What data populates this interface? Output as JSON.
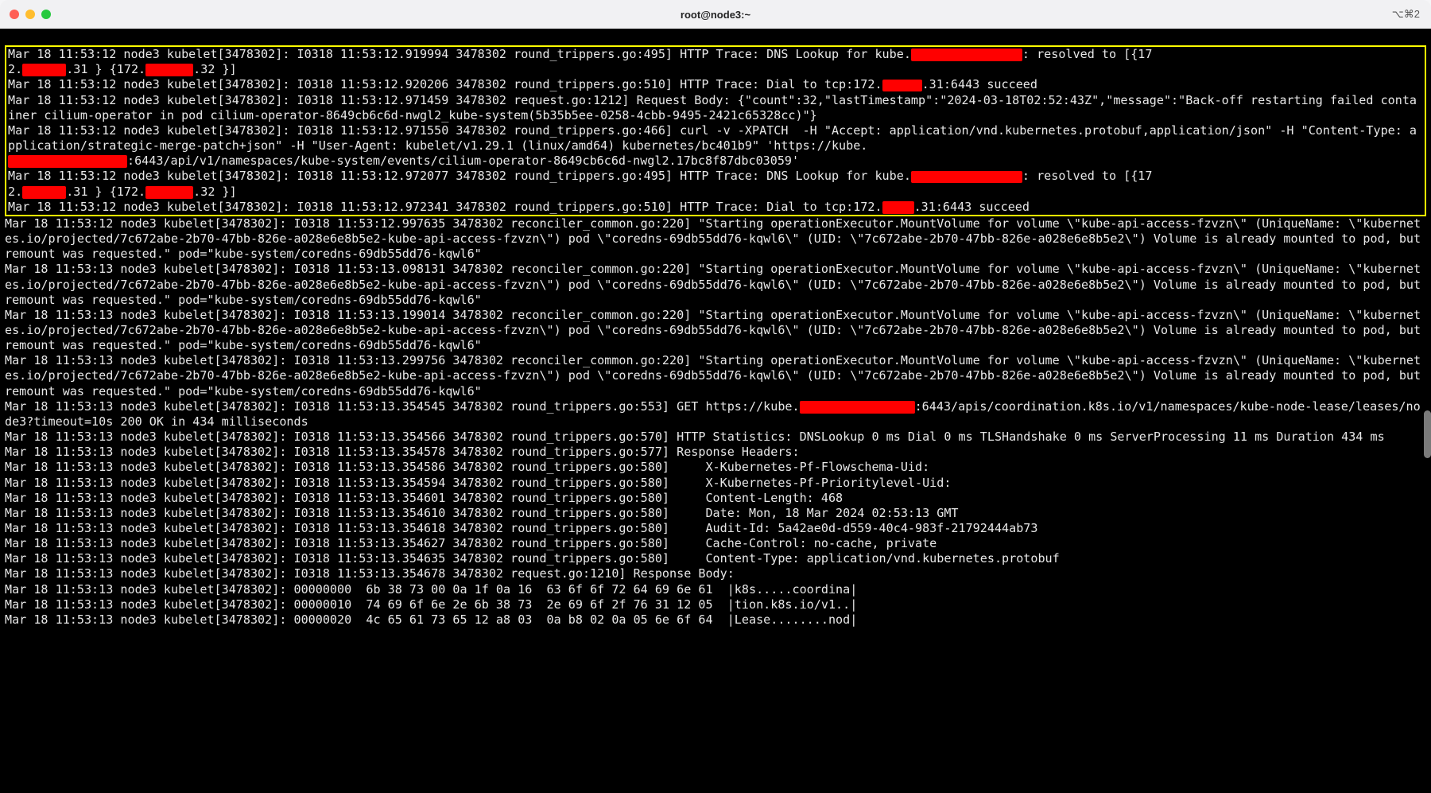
{
  "window": {
    "title": "root@node3:~",
    "shortcut": "⌥⌘2"
  },
  "highlighted_log_lines": [
    "Mar 18 11:53:12 node3 kubelet[3478302]: I0318 11:53:12.919994 3478302 round_trippers.go:495] HTTP Trace: DNS Lookup for kube.",
    ": resolved to [{17",
    "2.",
    ".31 } {172.",
    ".32 }]",
    "Mar 18 11:53:12 node3 kubelet[3478302]: I0318 11:53:12.920206 3478302 round_trippers.go:510] HTTP Trace: Dial to tcp:172.",
    ".31:6443 succeed",
    "Mar 18 11:53:12 node3 kubelet[3478302]: I0318 11:53:12.971459 3478302 request.go:1212] Request Body: {\"count\":32,\"lastTimestamp\":\"2024-03-18T02:52:43Z\",\"message\":\"Back-off restarting failed container cilium-operator in pod cilium-operator-8649cb6c6d-nwgl2_kube-system(5b35b5ee-0258-4cbb-9495-2421c65328cc)\"}",
    "Mar 18 11:53:12 node3 kubelet[3478302]: I0318 11:53:12.971550 3478302 round_trippers.go:466] curl -v -XPATCH  -H \"Accept: application/vnd.kubernetes.protobuf,application/json\" -H \"Content-Type: application/strategic-merge-patch+json\" -H \"User-Agent: kubelet/v1.29.1 (linux/amd64) kubernetes/bc401b9\" 'https://kube.",
    ":6443/api/v1/namespaces/kube-system/events/cilium-operator-8649cb6c6d-nwgl2.17bc8f87dbc03059'",
    "Mar 18 11:53:12 node3 kubelet[3478302]: I0318 11:53:12.972077 3478302 round_trippers.go:495] HTTP Trace: DNS Lookup for kube.",
    ": resolved to [{17",
    "2.",
    ".31 } {172.",
    ".32 }]",
    "Mar 18 11:53:12 node3 kubelet[3478302]: I0318 11:53:12.972341 3478302 round_trippers.go:510] HTTP Trace: Dial to tcp:172.",
    ".31:6443 succeed"
  ],
  "log_lines": [
    "Mar 18 11:53:12 node3 kubelet[3478302]: I0318 11:53:12.997635 3478302 reconciler_common.go:220] \"Starting operationExecutor.MountVolume for volume \\\"kube-api-access-fzvzn\\\" (UniqueName: \\\"kubernetes.io/projected/7c672abe-2b70-47bb-826e-a028e6e8b5e2-kube-api-access-fzvzn\\\") pod \\\"coredns-69db55dd76-kqwl6\\\" (UID: \\\"7c672abe-2b70-47bb-826e-a028e6e8b5e2\\\") Volume is already mounted to pod, but remount was requested.\" pod=\"kube-system/coredns-69db55dd76-kqwl6\"",
    "Mar 18 11:53:13 node3 kubelet[3478302]: I0318 11:53:13.098131 3478302 reconciler_common.go:220] \"Starting operationExecutor.MountVolume for volume \\\"kube-api-access-fzvzn\\\" (UniqueName: \\\"kubernetes.io/projected/7c672abe-2b70-47bb-826e-a028e6e8b5e2-kube-api-access-fzvzn\\\") pod \\\"coredns-69db55dd76-kqwl6\\\" (UID: \\\"7c672abe-2b70-47bb-826e-a028e6e8b5e2\\\") Volume is already mounted to pod, but remount was requested.\" pod=\"kube-system/coredns-69db55dd76-kqwl6\"",
    "Mar 18 11:53:13 node3 kubelet[3478302]: I0318 11:53:13.199014 3478302 reconciler_common.go:220] \"Starting operationExecutor.MountVolume for volume \\\"kube-api-access-fzvzn\\\" (UniqueName: \\\"kubernetes.io/projected/7c672abe-2b70-47bb-826e-a028e6e8b5e2-kube-api-access-fzvzn\\\") pod \\\"coredns-69db55dd76-kqwl6\\\" (UID: \\\"7c672abe-2b70-47bb-826e-a028e6e8b5e2\\\") Volume is already mounted to pod, but remount was requested.\" pod=\"kube-system/coredns-69db55dd76-kqwl6\"",
    "Mar 18 11:53:13 node3 kubelet[3478302]: I0318 11:53:13.299756 3478302 reconciler_common.go:220] \"Starting operationExecutor.MountVolume for volume \\\"kube-api-access-fzvzn\\\" (UniqueName: \\\"kubernetes.io/projected/7c672abe-2b70-47bb-826e-a028e6e8b5e2-kube-api-access-fzvzn\\\") pod \\\"coredns-69db55dd76-kqwl6\\\" (UID: \\\"7c672abe-2b70-47bb-826e-a028e6e8b5e2\\\") Volume is already mounted to pod, but remount was requested.\" pod=\"kube-system/coredns-69db55dd76-kqwl6\"",
    "Mar 18 11:53:13 node3 kubelet[3478302]: I0318 11:53:13.354545 3478302 round_trippers.go:553] GET https://kube.",
    ":6443/apis/coordination.k8s.io/v1/namespaces/kube-node-lease/leases/node3?timeout=10s 200 OK in 434 milliseconds",
    "Mar 18 11:53:13 node3 kubelet[3478302]: I0318 11:53:13.354566 3478302 round_trippers.go:570] HTTP Statistics: DNSLookup 0 ms Dial 0 ms TLSHandshake 0 ms ServerProcessing 11 ms Duration 434 ms",
    "Mar 18 11:53:13 node3 kubelet[3478302]: I0318 11:53:13.354578 3478302 round_trippers.go:577] Response Headers:",
    "Mar 18 11:53:13 node3 kubelet[3478302]: I0318 11:53:13.354586 3478302 round_trippers.go:580]     X-Kubernetes-Pf-Flowschema-Uid:",
    "Mar 18 11:53:13 node3 kubelet[3478302]: I0318 11:53:13.354594 3478302 round_trippers.go:580]     X-Kubernetes-Pf-Prioritylevel-Uid:",
    "Mar 18 11:53:13 node3 kubelet[3478302]: I0318 11:53:13.354601 3478302 round_trippers.go:580]     Content-Length: 468",
    "Mar 18 11:53:13 node3 kubelet[3478302]: I0318 11:53:13.354610 3478302 round_trippers.go:580]     Date: Mon, 18 Mar 2024 02:53:13 GMT",
    "Mar 18 11:53:13 node3 kubelet[3478302]: I0318 11:53:13.354618 3478302 round_trippers.go:580]     Audit-Id: 5a42ae0d-d559-40c4-983f-21792444ab73",
    "Mar 18 11:53:13 node3 kubelet[3478302]: I0318 11:53:13.354627 3478302 round_trippers.go:580]     Cache-Control: no-cache, private",
    "Mar 18 11:53:13 node3 kubelet[3478302]: I0318 11:53:13.354635 3478302 round_trippers.go:580]     Content-Type: application/vnd.kubernetes.protobuf",
    "Mar 18 11:53:13 node3 kubelet[3478302]: I0318 11:53:13.354678 3478302 request.go:1210] Response Body:",
    "Mar 18 11:53:13 node3 kubelet[3478302]: 00000000  6b 38 73 00 0a 1f 0a 16  63 6f 6f 72 64 69 6e 61  |k8s.....coordina|",
    "Mar 18 11:53:13 node3 kubelet[3478302]: 00000010  74 69 6f 6e 2e 6b 38 73  2e 69 6f 2f 76 31 12 05  |tion.k8s.io/v1..|",
    "Mar 18 11:53:13 node3 kubelet[3478302]: 00000020  4c 65 61 73 65 12 a8 03  0a b8 02 0a 05 6e 6f 64  |Lease........nod|"
  ]
}
